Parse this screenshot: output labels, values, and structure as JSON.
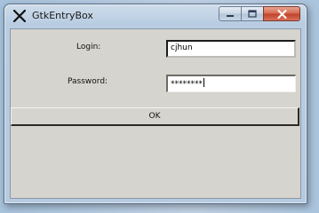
{
  "window": {
    "title": "GtkEntryBox"
  },
  "form": {
    "login_label": "Login:",
    "login_value": "cjhun",
    "password_label": "Password:",
    "password_value": "********"
  },
  "buttons": {
    "ok_label": "OK"
  },
  "icons": {
    "app": "x-logo-icon",
    "minimize": "minimize-icon",
    "maximize": "maximize-icon",
    "close": "close-icon"
  },
  "colors": {
    "dialog_bg": "#d6d4ce",
    "close_button": "#c9523a"
  }
}
